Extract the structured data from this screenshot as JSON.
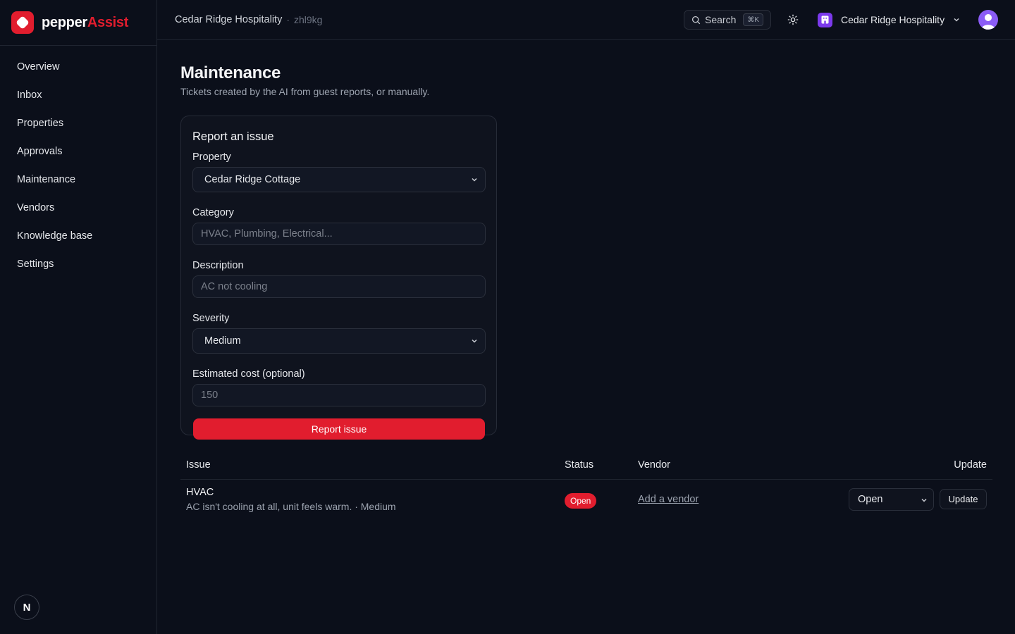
{
  "brand": {
    "name_part1": "pepper",
    "name_part2": "Assist",
    "accent": "#e11d2e"
  },
  "sidebar": {
    "items": [
      {
        "label": "Overview"
      },
      {
        "label": "Inbox"
      },
      {
        "label": "Properties"
      },
      {
        "label": "Approvals"
      },
      {
        "label": "Maintenance"
      },
      {
        "label": "Vendors"
      },
      {
        "label": "Knowledge base"
      },
      {
        "label": "Settings"
      }
    ],
    "footer_badge": "N"
  },
  "topbar": {
    "breadcrumb": "Cedar Ridge Hospitality",
    "separator": "·",
    "workspace_id": "zhl9kg",
    "search_label": "Search",
    "search_shortcut": "⌘K",
    "org_name": "Cedar Ridge Hospitality"
  },
  "page": {
    "title": "Maintenance",
    "subtitle": "Tickets created by the AI from guest reports, or manually."
  },
  "form": {
    "title": "Report an issue",
    "property_label": "Property",
    "property_value": "Cedar Ridge Cottage",
    "category_label": "Category",
    "category_placeholder": "HVAC, Plumbing, Electrical...",
    "description_label": "Description",
    "description_placeholder": "AC not cooling",
    "severity_label": "Severity",
    "severity_value": "Medium",
    "cost_label": "Estimated cost (optional)",
    "cost_placeholder": "150",
    "submit_label": "Report issue"
  },
  "table": {
    "headers": {
      "issue": "Issue",
      "status": "Status",
      "vendor": "Vendor",
      "update": "Update"
    },
    "rows": [
      {
        "title": "HVAC",
        "description": "AC isn't cooling at all, unit feels warm. · Medium",
        "status": "Open",
        "vendor_link": "Add a vendor",
        "status_select": "Open",
        "update_label": "Update"
      }
    ]
  }
}
